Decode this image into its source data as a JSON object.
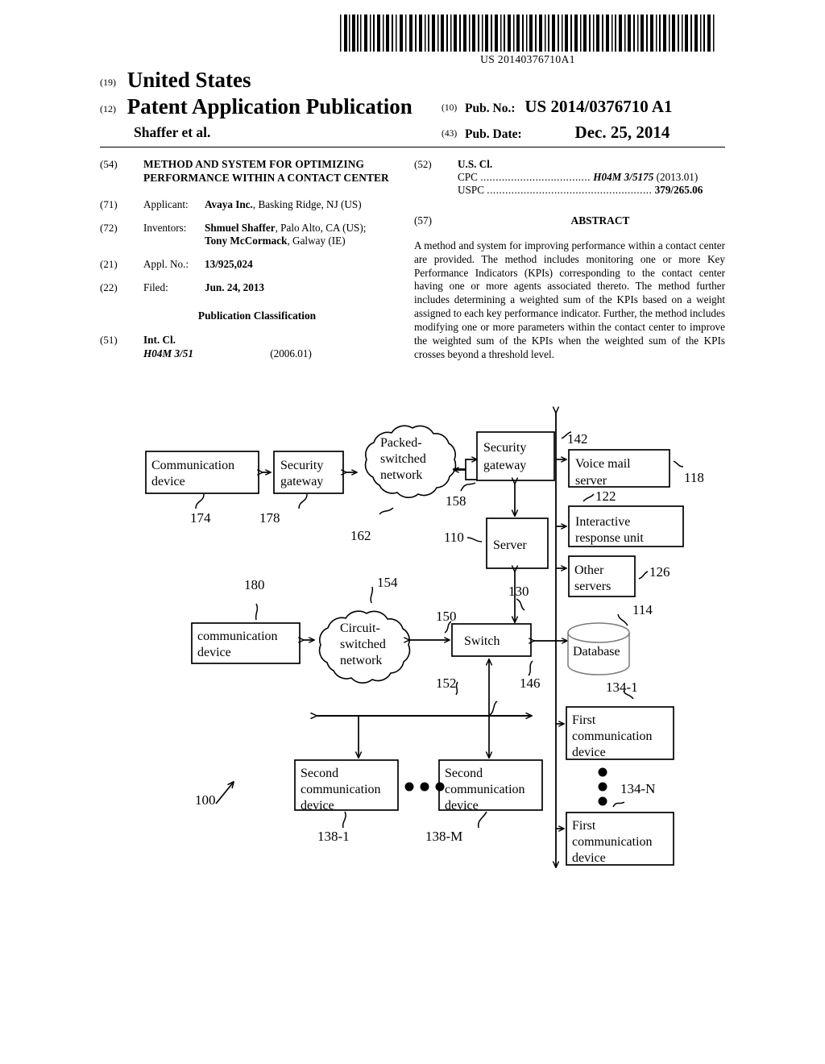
{
  "barcode": {
    "number": "US 20140376710A1"
  },
  "masthead": {
    "kind_19": "(19)",
    "country": "United States",
    "kind_12": "(12)",
    "doc_type": "Patent Application Publication",
    "inventor_short": "Shaffer et al.",
    "pubno_num": "(10)",
    "pubno_label": "Pub. No.:",
    "pubno_value": "US 2014/0376710 A1",
    "pubdate_num": "(43)",
    "pubdate_label": "Pub. Date:",
    "pubdate_value": "Dec. 25, 2014"
  },
  "left_column": {
    "title_num": "(54)",
    "title": "METHOD AND SYSTEM FOR OPTIMIZING PERFORMANCE WITHIN A CONTACT CENTER",
    "applicant_num": "(71)",
    "applicant_label": "Applicant:",
    "applicant_name": "Avaya Inc.",
    "applicant_rest": ", Basking Ridge, NJ (US)",
    "inventors_num": "(72)",
    "inventors_label": "Inventors:",
    "inventor1_name": "Shmuel Shaffer",
    "inventor1_rest": ", Palo Alto, CA (US);",
    "inventor2_name": "Tony McCormack",
    "inventor2_rest": ", Galway (IE)",
    "applno_num": "(21)",
    "applno_label": "Appl. No.:",
    "applno_value": "13/925,024",
    "filed_num": "(22)",
    "filed_label": "Filed:",
    "filed_value": "Jun. 24, 2013",
    "pubclass_heading": "Publication Classification",
    "intcl_num": "(51)",
    "intcl_label": "Int. Cl.",
    "intcl_value": "H04M 3/51",
    "intcl_date": "(2006.01)"
  },
  "right_column": {
    "uscl_num": "(52)",
    "uscl_label": "U.S. Cl.",
    "cpc_label": "CPC",
    "cpc_dots": "....................................",
    "cpc_value": "H04M 3/5175",
    "cpc_date": "(2013.01)",
    "uspc_label": "USPC",
    "uspc_dots": "......................................................",
    "uspc_value": "379/265.06",
    "abstract_num": "(57)",
    "abstract_heading": "ABSTRACT",
    "abstract_text": "A method and system for improving performance within a contact center are provided. The method includes monitoring one or more Key Performance Indicators (KPIs) corresponding to the contact center having one or more agents associated thereto. The method further includes determining a weighted sum of the KPIs based on a weight assigned to each key performance indicator. Further, the method includes modifying one or more parameters within the contact center to improve the weighted sum of the KPIs when the weighted sum of the KPIs crosses beyond a threshold level."
  },
  "figure": {
    "system_ref": "100",
    "nodes": {
      "communication_device_top": "Communication device",
      "security_gateway_left": "Security gateway",
      "packet_network": "Packed- switched network",
      "security_gateway_right": "Security gateway",
      "voice_mail_server": "Voice mail server",
      "interactive_response_unit": "Interactive response unit",
      "other_servers": "Other servers",
      "server": "Server",
      "switch": "Switch",
      "database": "Database",
      "communication_device_bottom": "communication device",
      "circuit_network": "Circuit- switched network",
      "first_communication_device_1": "First communication device",
      "first_communication_device_n": "First communication device",
      "second_communication_device_1": "Second communication device",
      "second_communication_device_m": "Second communication device"
    },
    "node_lines": {
      "communication_device_top": [
        "Communication",
        "device"
      ],
      "security_gateway_left": [
        "Security",
        "gateway"
      ],
      "packet_network": [
        "Packed-",
        "switched",
        "network"
      ],
      "security_gateway_right": [
        "Security",
        "gateway"
      ],
      "voice_mail_server": [
        "Voice mail",
        "server"
      ],
      "interactive_response_unit": [
        "Interactive",
        "response unit"
      ],
      "other_servers": [
        "Other",
        "servers"
      ],
      "server": [
        "Server"
      ],
      "switch": [
        "Switch"
      ],
      "database": [
        "Database"
      ],
      "communication_device_bottom": [
        "communication",
        "device"
      ],
      "circuit_network": [
        "Circuit-",
        "switched",
        "network"
      ],
      "first_communication_device_1": [
        "First",
        "communication",
        "device"
      ],
      "first_communication_device_n": [
        "First",
        "communication",
        "device"
      ],
      "second_communication_device_1": [
        "Second",
        "communication",
        "device"
      ],
      "second_communication_device_m": [
        "Second",
        "communication",
        "device"
      ]
    },
    "ref_numerals": {
      "r174": "174",
      "r178": "178",
      "r162": "162",
      "r158": "158",
      "r142": "142",
      "r118": "118",
      "r122": "122",
      "r126": "126",
      "r110": "110",
      "r130": "130",
      "r114": "114",
      "r180": "180",
      "r154": "154",
      "r150": "150",
      "r152": "152",
      "r146": "146",
      "r134_1": "134-1",
      "r134_n": "134-N",
      "r138_1": "138-1",
      "r138_m": "138-M",
      "r100": "100"
    }
  },
  "colors": {
    "ink": "#000000",
    "paper": "#ffffff",
    "database_outline": "#7a7a7a"
  }
}
